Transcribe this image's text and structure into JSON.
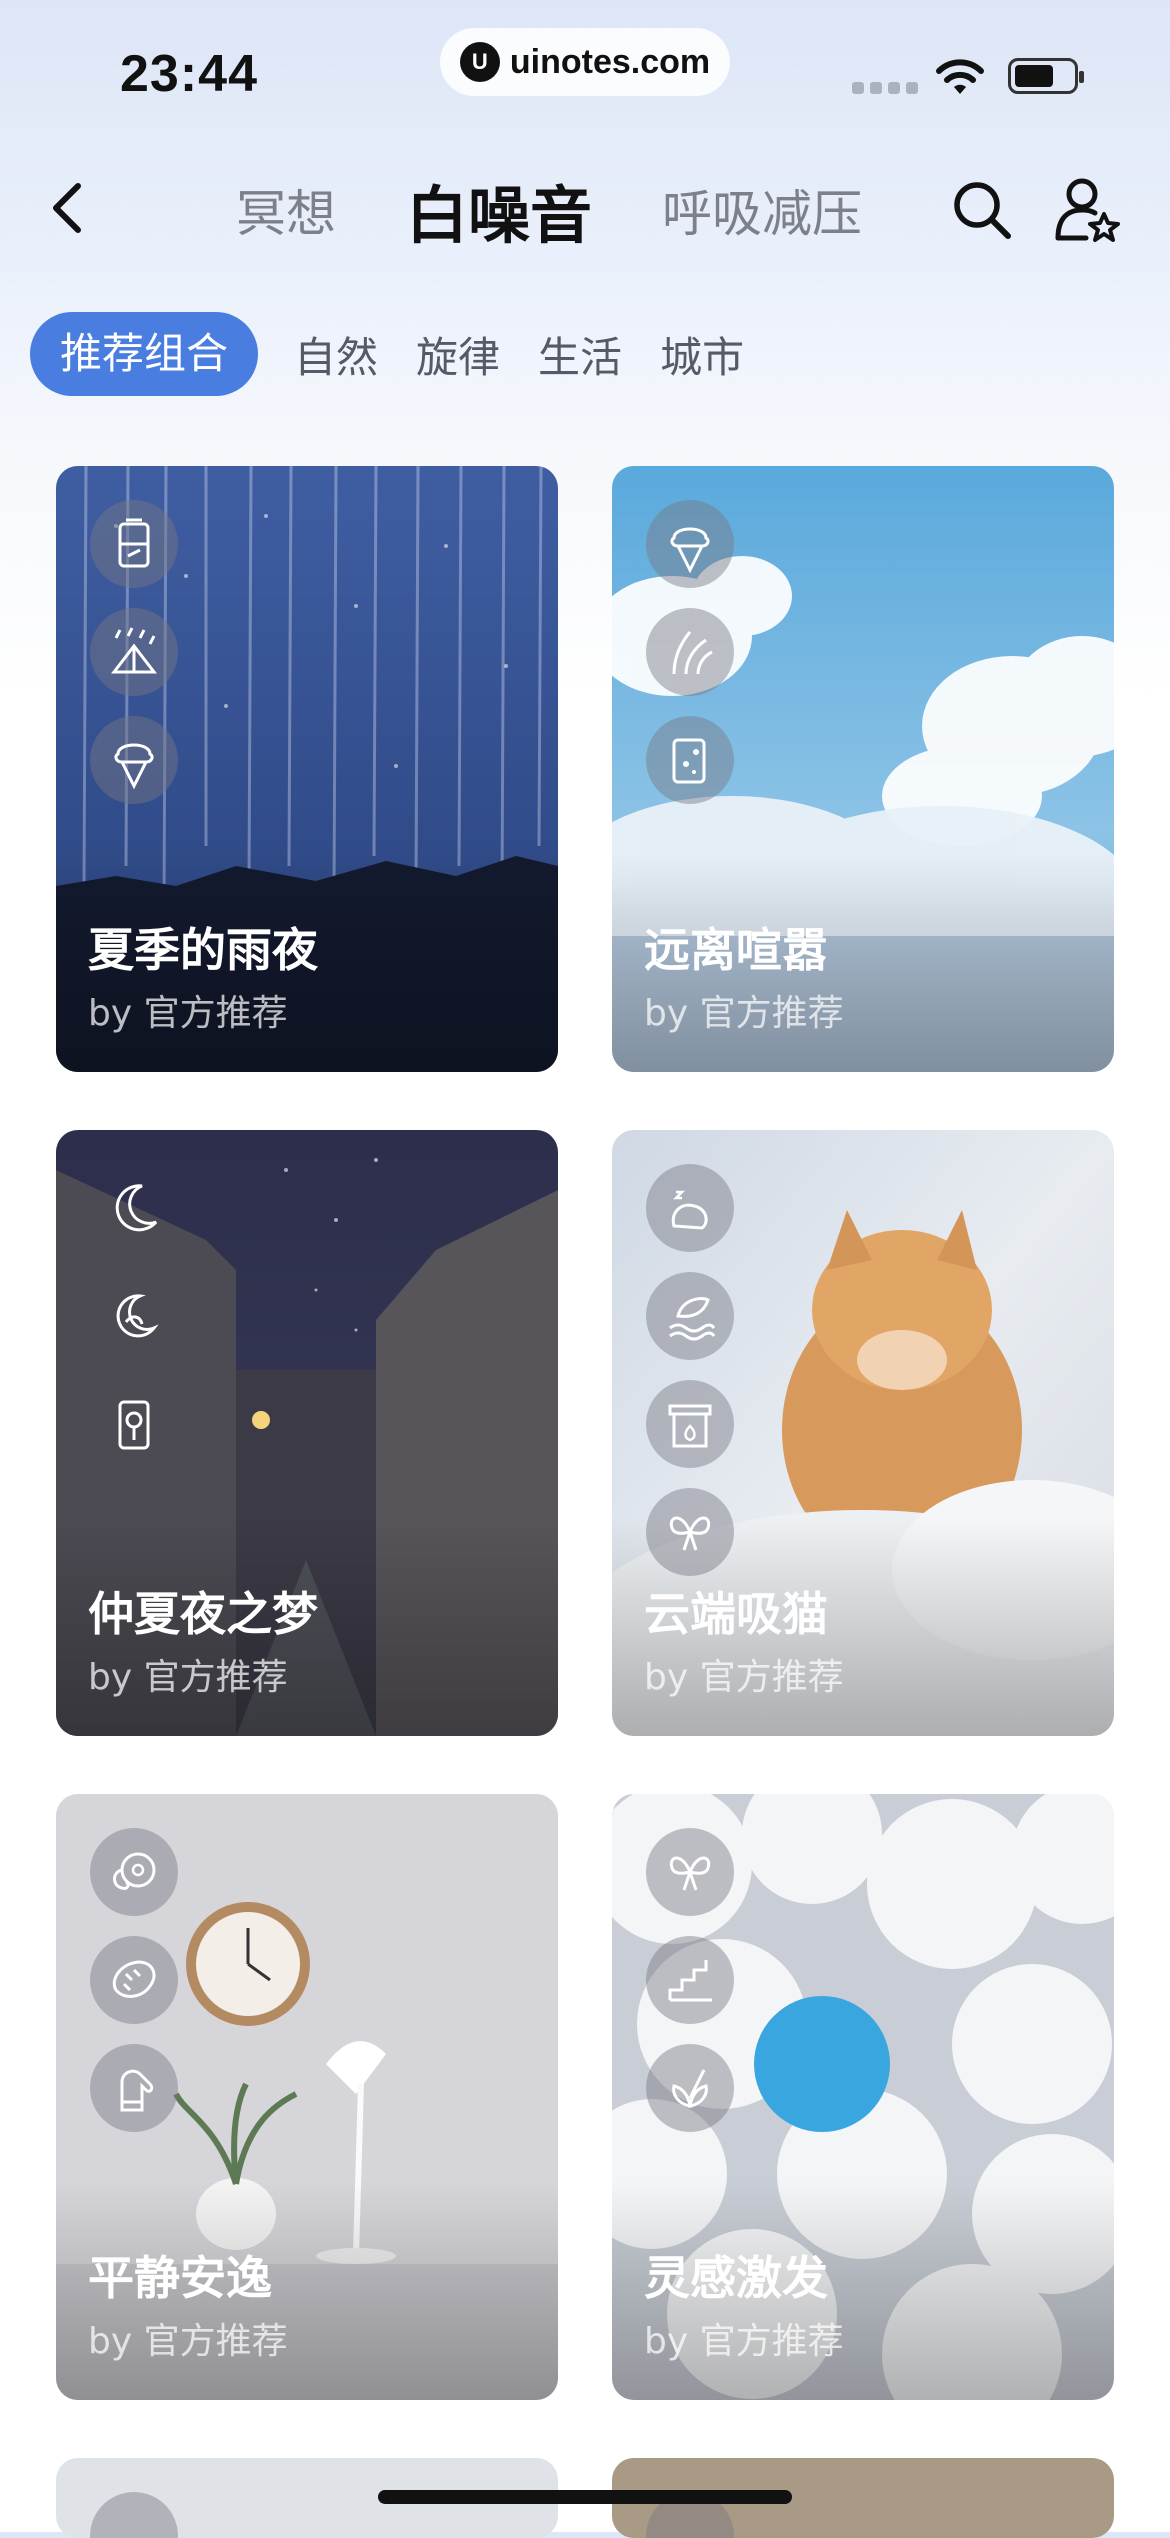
{
  "status": {
    "time": "23:44",
    "url": "uinotes.com"
  },
  "nav": {
    "tabs": [
      {
        "label": "冥想",
        "active": false
      },
      {
        "label": "白噪音",
        "active": true
      },
      {
        "label": "呼吸减压",
        "active": false
      }
    ]
  },
  "chips": [
    "推荐组合",
    "自然",
    "旋律",
    "生活",
    "城市"
  ],
  "cards": [
    {
      "title": "夏季的雨夜",
      "sub": "by 官方推荐",
      "icons": [
        "battery-lantern-icon",
        "rain-tent-icon",
        "ice-cream-icon"
      ]
    },
    {
      "title": "远离喧嚣",
      "sub": "by 官方推荐",
      "icons": [
        "ice-cream-icon",
        "grass-icon",
        "scroll-icon"
      ]
    },
    {
      "title": "仲夏夜之梦",
      "sub": "by 官方推荐",
      "icons": [
        "moon-icon",
        "moon-leaf-icon",
        "clock-icon"
      ]
    },
    {
      "title": "云端吸猫",
      "sub": "by 官方推荐",
      "icons": [
        "sleeping-cat-icon",
        "wave-leaf-icon",
        "fireplace-icon",
        "butterfly-icon"
      ]
    },
    {
      "title": "平静安逸",
      "sub": "by 官方推荐",
      "icons": [
        "record-player-icon",
        "bread-icon",
        "glove-icon"
      ]
    },
    {
      "title": "灵感激发",
      "sub": "by 官方推荐",
      "icons": [
        "butterfly-icon",
        "stairs-icon",
        "flower-icon"
      ]
    }
  ]
}
